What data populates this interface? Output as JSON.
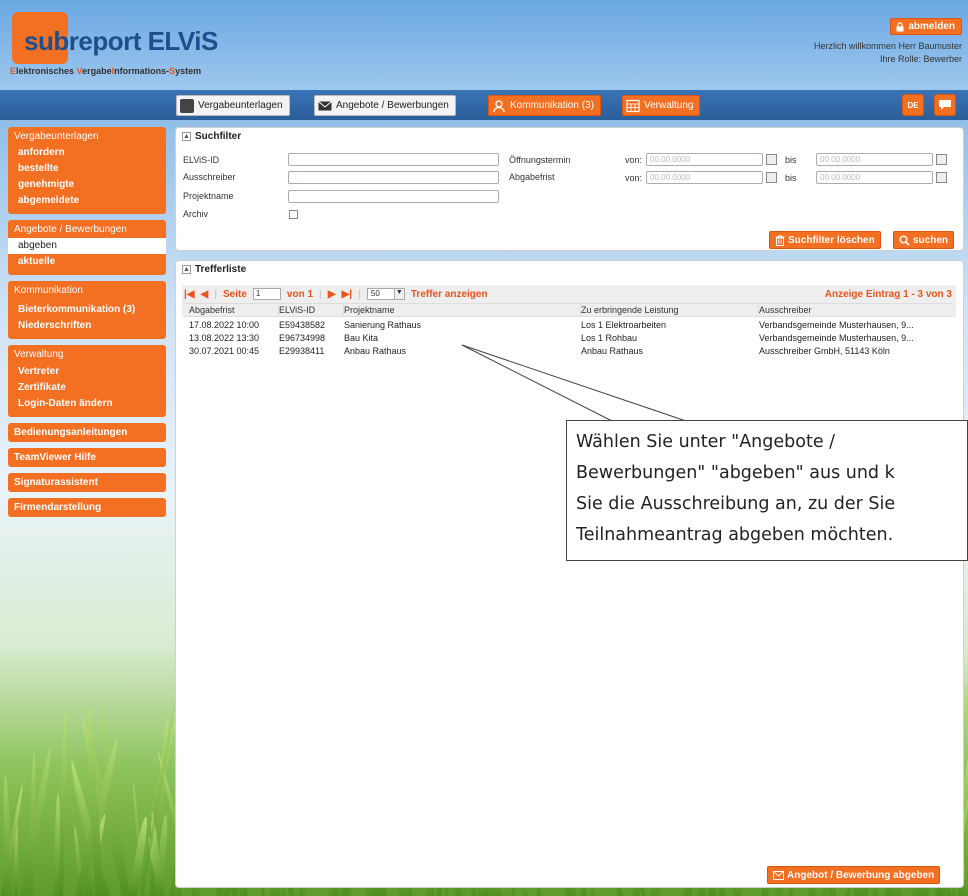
{
  "app": {
    "logo_sub": "sub",
    "logo_main": "report ELViS",
    "logo_tagline_prefix": "E",
    "logo_tagline_1": "lektronisches ",
    "logo_tagline_v": "V",
    "logo_tagline_2": "ergabe",
    "logo_tagline_i": "I",
    "logo_tagline_3": "nformations-",
    "logo_tagline_s": "S",
    "logo_tagline_4": "ystem"
  },
  "header": {
    "logout_label": "abmelden",
    "welcome_line": "Herzlich willkommen Herr Baumuster",
    "role_line": "Ihre Rolle: Bewerber"
  },
  "nav": {
    "tabs": [
      {
        "label": "Vergabeunterlagen"
      },
      {
        "label": "Angebote / Bewerbungen"
      },
      {
        "label": "Kommunikation (3)"
      },
      {
        "label": "Verwaltung"
      }
    ],
    "lang": "DE"
  },
  "sidebar": {
    "vergabe": {
      "title": "Vergabeunterlagen",
      "items": [
        "anfordern",
        "bestellte",
        "genehmigte",
        "abgemeldete"
      ]
    },
    "angebote": {
      "title": "Angebote / Bewerbungen",
      "items": [
        "abgeben",
        "aktuelle"
      ]
    },
    "kommunikation": {
      "title": "Kommunikation",
      "items": [
        "Bieterkommunikation (3)",
        "Niederschriften"
      ]
    },
    "verwaltung": {
      "title": "Verwaltung",
      "items": [
        "Vertreter",
        "Zertifikate",
        "Login-Daten ändern"
      ]
    },
    "singles": [
      "Bedienungsanleitungen",
      "TeamViewer Hilfe",
      "Signaturassistent",
      "Firmendarstellung"
    ]
  },
  "filter": {
    "title": "Suchfilter",
    "labels": {
      "elvis_id": "ELViS-ID",
      "ausschreiber": "Ausschreiber",
      "projektname": "Projektname",
      "archiv": "Archiv",
      "oeffnungstermin": "Öffnungstermin",
      "abgabefrist": "Abgabefrist",
      "von": "von:",
      "bis": "bis"
    },
    "date_placeholder": "00.00.0000",
    "clear_label": "Suchfilter löschen",
    "search_label": "suchen"
  },
  "results": {
    "title": "Trefferliste",
    "page_label": "Seite",
    "page_value": "1",
    "of_label": "von 1",
    "per_page": "50",
    "show_label": "Treffer anzeigen",
    "summary": "Anzeige Eintrag 1 - 3 von 3",
    "columns": [
      "Abgabefrist",
      "ELViS-ID",
      "Projektname",
      "Zu erbringende Leistung",
      "Ausschreiber"
    ],
    "rows": [
      [
        "17.08.2022 10:00",
        "E59438582",
        "Sanierung Rathaus",
        "Los 1 Elektroarbeiten",
        "Verbandsgemeinde Musterhausen, 9..."
      ],
      [
        "13.08.2022 13:30",
        "E96734998",
        "Bau Kita",
        "Los 1 Rohbau",
        "Verbandsgemeinde Musterhausen, 9..."
      ],
      [
        "30.07.2021 00:45",
        "E29938411",
        "Anbau Rathaus",
        "Anbau Rathaus",
        "Ausschreiber GmbH, 51143 Köln"
      ]
    ],
    "submit_label": "Angebot / Bewerbung abgeben"
  },
  "callout": {
    "line1": "Wählen Sie unter \"Angebote /",
    "line2": "Bewerbungen\" \"abgeben\" aus und k",
    "line3": "Sie die Ausschreibung an, zu der Sie",
    "line4": "Teilnahmeantrag abgeben möchten."
  },
  "colors": {
    "brand_orange": "#f36f21",
    "brand_blue": "#1e4f8c",
    "nav_blue": "#2b5d99"
  }
}
